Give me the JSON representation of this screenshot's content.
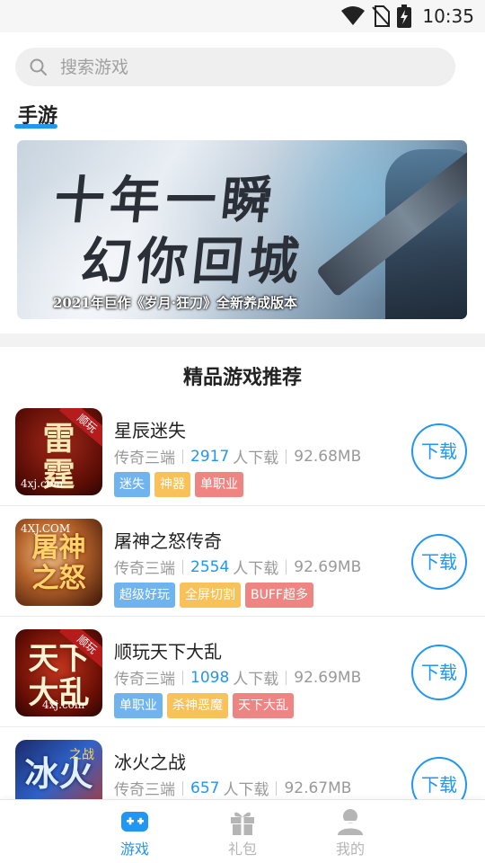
{
  "status_bar": {
    "time": "10:35",
    "icons": [
      "wifi-icon",
      "no-sim-icon",
      "battery-charging-icon"
    ]
  },
  "search": {
    "placeholder": "搜索游戏"
  },
  "section": {
    "title": "手游"
  },
  "banner": {
    "headline_line1": "十年一瞬",
    "headline_line2": "幻你回城",
    "slogan": "2021年巨作《岁月·狂刀》全新养成版本"
  },
  "recommend": {
    "title": "精品游戏推荐"
  },
  "games": [
    {
      "name": "星辰迷失",
      "category": "传奇三端",
      "downloads": "2917",
      "downloads_suffix": "人下载",
      "size": "92.68MB",
      "tags": [
        "迷失",
        "神器",
        "单职业"
      ],
      "icon_text": "雷霆",
      "icon_site": "4xj.com",
      "icon_ribbon": "顺玩",
      "download_label": "下载"
    },
    {
      "name": "屠神之怒传奇",
      "category": "传奇三端",
      "downloads": "2554",
      "downloads_suffix": "人下载",
      "size": "92.69MB",
      "tags": [
        "超级好玩",
        "全屏切割",
        "BUFF超多"
      ],
      "icon_text": "屠神之怒",
      "icon_site": "4XJ.COM",
      "icon_ribbon": "",
      "download_label": "下载"
    },
    {
      "name": "顺玩天下大乱",
      "category": "传奇三端",
      "downloads": "1098",
      "downloads_suffix": "人下载",
      "size": "92.69MB",
      "tags": [
        "单职业",
        "杀神恶魔",
        "天下大乱"
      ],
      "icon_text": "天下大乱",
      "icon_site": "4xj.com",
      "icon_ribbon": "顺玩",
      "download_label": "下载"
    },
    {
      "name": "冰火之战",
      "category": "传奇三端",
      "downloads": "657",
      "downloads_suffix": "人下载",
      "size": "92.67MB",
      "tags": [],
      "icon_text": "冰火",
      "icon_site": "",
      "icon_ribbon": "之战",
      "download_label": "下载"
    }
  ],
  "tag_colors": [
    "#6fb3ef",
    "#f8c15a",
    "#ef8582"
  ],
  "bottom_nav": {
    "active_color": "#2196f3",
    "inactive_color": "#b5b5b5",
    "items": [
      {
        "label": "游戏",
        "icon": "gamepad-icon",
        "active": true
      },
      {
        "label": "礼包",
        "icon": "gift-icon",
        "active": false
      },
      {
        "label": "我的",
        "icon": "user-icon",
        "active": false
      }
    ]
  }
}
